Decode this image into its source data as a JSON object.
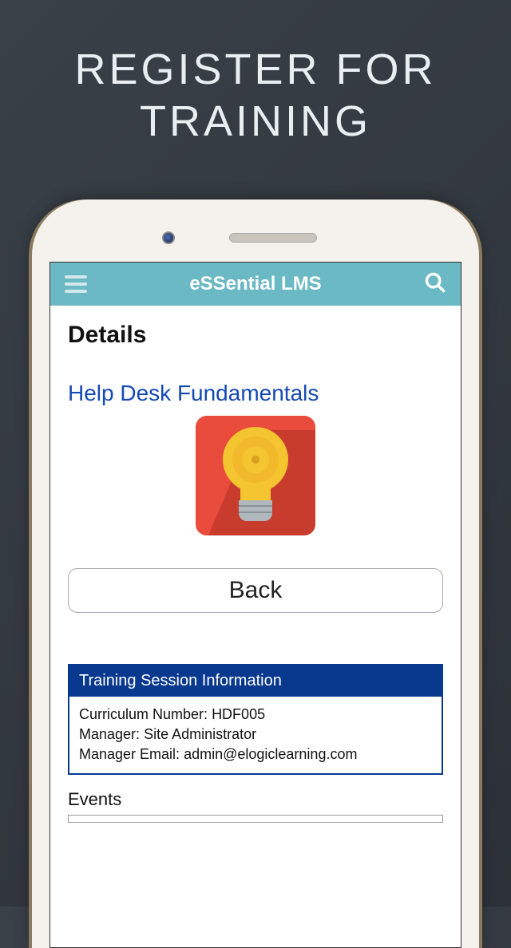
{
  "promo": {
    "line1": "REGISTER FOR",
    "line2": "TRAINING"
  },
  "header": {
    "title": "eSSential LMS"
  },
  "page": {
    "heading": "Details",
    "course_title": "Help Desk Fundamentals",
    "back_label": "Back"
  },
  "session_panel": {
    "title": "Training Session Information",
    "curriculum_label": "Curriculum Number:",
    "curriculum_value": "HDF005",
    "manager_label": "Manager:",
    "manager_value": "Site Administrator",
    "email_label": "Manager Email:",
    "email_value": "admin@elogiclearning.com"
  },
  "events": {
    "heading": "Events"
  }
}
